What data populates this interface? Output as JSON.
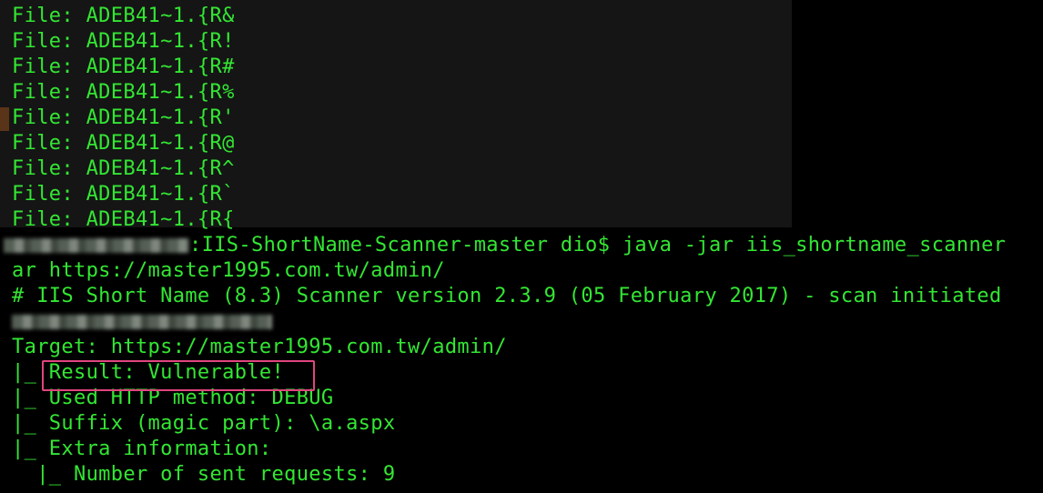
{
  "terminal": {
    "file_lines": [
      "File: ADEB41~1.{R&",
      "File: ADEB41~1.{R!",
      "File: ADEB41~1.{R#",
      "File: ADEB41~1.{R%",
      "File: ADEB41~1.{R'",
      "File: ADEB41~1.{R@",
      "File: ADEB41~1.{R^",
      "File: ADEB41~1.{R`",
      "File: ADEB41~1.{R{"
    ],
    "prompt_suffix": ":IIS-ShortName-Scanner-master dio$ java -jar iis_shortname_scanner",
    "command_wrap": "ar https://master1995.com.tw/admin/",
    "scanner_banner": "# IIS Short Name (8.3) Scanner version 2.3.9 (05 February 2017) - scan initiated",
    "target_line": "Target: https://master1995.com.tw/admin/",
    "result_line": "|_ Result: Vulnerable!",
    "method_line": "|_ Used HTTP method: DEBUG",
    "suffix_line": "|_ Suffix (magic part): \\a.aspx",
    "extra_line": "|_ Extra information:",
    "requests_line": "  |_ Number of sent requests: 9"
  },
  "colors": {
    "background": "#000000",
    "text": "#33e633",
    "highlight": "#e0457f"
  }
}
